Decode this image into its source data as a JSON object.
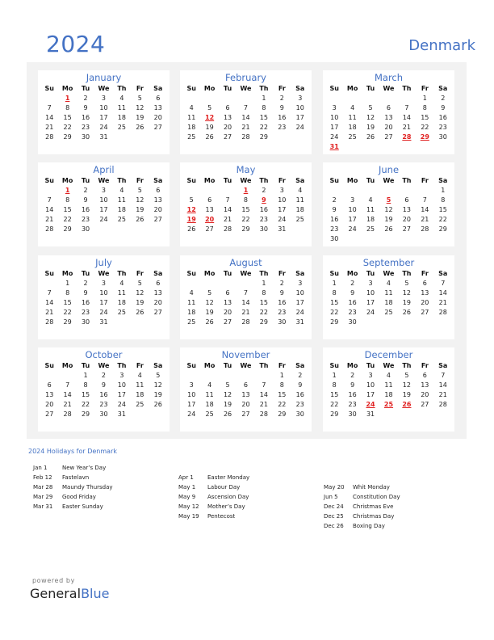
{
  "header": {
    "year": "2024",
    "country": "Denmark"
  },
  "weekday_labels": [
    "Su",
    "Mo",
    "Tu",
    "We",
    "Th",
    "Fr",
    "Sa"
  ],
  "months": [
    {
      "name": "January",
      "start": 1,
      "days": 31,
      "holidays": [
        1
      ]
    },
    {
      "name": "February",
      "start": 4,
      "days": 29,
      "holidays": [
        12
      ]
    },
    {
      "name": "March",
      "start": 5,
      "days": 31,
      "holidays": [
        28,
        29,
        31
      ]
    },
    {
      "name": "April",
      "start": 1,
      "days": 30,
      "holidays": [
        1
      ]
    },
    {
      "name": "May",
      "start": 3,
      "days": 31,
      "holidays": [
        1,
        9,
        12,
        19,
        20
      ]
    },
    {
      "name": "June",
      "start": 6,
      "days": 30,
      "holidays": [
        5
      ]
    },
    {
      "name": "July",
      "start": 1,
      "days": 31,
      "holidays": []
    },
    {
      "name": "August",
      "start": 4,
      "days": 31,
      "holidays": []
    },
    {
      "name": "September",
      "start": 0,
      "days": 30,
      "holidays": []
    },
    {
      "name": "October",
      "start": 2,
      "days": 31,
      "holidays": []
    },
    {
      "name": "November",
      "start": 5,
      "days": 30,
      "holidays": []
    },
    {
      "name": "December",
      "start": 0,
      "days": 31,
      "holidays": [
        24,
        25,
        26
      ]
    }
  ],
  "holidays_title": "2024 Holidays for Denmark",
  "holiday_columns": [
    [
      {
        "date": "Jan 1",
        "name": "New Year’s Day"
      },
      {
        "date": "Feb 12",
        "name": "Fastelavn"
      },
      {
        "date": "Mar 28",
        "name": "Maundy Thursday"
      },
      {
        "date": "Mar 29",
        "name": "Good Friday"
      },
      {
        "date": "Mar 31",
        "name": "Easter Sunday"
      }
    ],
    [
      {
        "date": "Apr 1",
        "name": "Easter Monday"
      },
      {
        "date": "May 1",
        "name": "Labour Day"
      },
      {
        "date": "May 9",
        "name": "Ascension Day"
      },
      {
        "date": "May 12",
        "name": "Mother’s Day"
      },
      {
        "date": "May 19",
        "name": "Pentecost"
      }
    ],
    [
      {
        "date": "May 20",
        "name": "Whit Monday"
      },
      {
        "date": "Jun 5",
        "name": "Constitution Day"
      },
      {
        "date": "Dec 24",
        "name": "Christmas Eve"
      },
      {
        "date": "Dec 25",
        "name": "Christmas Day"
      },
      {
        "date": "Dec 26",
        "name": "Boxing Day"
      }
    ]
  ],
  "footer": {
    "powered_by": "powered by",
    "brand_general": "General",
    "brand_blue": "Blue"
  }
}
